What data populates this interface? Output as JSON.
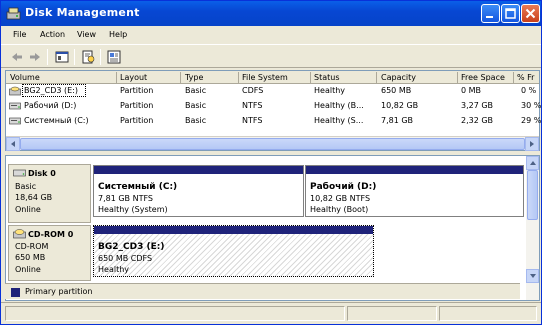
{
  "window": {
    "title": "Disk Management"
  },
  "menu": [
    "File",
    "Action",
    "View",
    "Help"
  ],
  "volume_list": {
    "columns": [
      "Volume",
      "Layout",
      "Type",
      "File System",
      "Status",
      "Capacity",
      "Free Space",
      "% Fr"
    ],
    "rows": [
      {
        "volume": "BG2_CD3 (E:)",
        "layout": "Partition",
        "type": "Basic",
        "fs": "CDFS",
        "status": "Healthy",
        "capacity": "650 MB",
        "free": "0 MB",
        "pct": "0 %"
      },
      {
        "volume": "Рабочий (D:)",
        "layout": "Partition",
        "type": "Basic",
        "fs": "NTFS",
        "status": "Healthy (B...",
        "capacity": "10,82 GB",
        "free": "3,27 GB",
        "pct": "30 %"
      },
      {
        "volume": "Системный (C:)",
        "layout": "Partition",
        "type": "Basic",
        "fs": "NTFS",
        "status": "Healthy (S...",
        "capacity": "7,81 GB",
        "free": "2,32 GB",
        "pct": "29 %"
      }
    ]
  },
  "disks": [
    {
      "name": "Disk 0",
      "kind": "Basic",
      "size": "18,64 GB",
      "state": "Online",
      "partitions": [
        {
          "title": "Системный (C:)",
          "detail": "7,81 GB NTFS",
          "status": "Healthy (System)"
        },
        {
          "title": "Рабочий (D:)",
          "detail": "10,82 GB NTFS",
          "status": "Healthy (Boot)"
        }
      ]
    },
    {
      "name": "CD-ROM 0",
      "kind": "CD-ROM",
      "size": "650 MB",
      "state": "Online",
      "partitions": [
        {
          "title": "BG2_CD3 (E:)",
          "detail": "650 MB CDFS",
          "status": "Healthy"
        }
      ]
    }
  ],
  "legend": {
    "label": "Primary partition",
    "color": "#1f237a"
  },
  "colors": {
    "titlebar": "#0747d3",
    "partition_bar": "#1f237a"
  }
}
